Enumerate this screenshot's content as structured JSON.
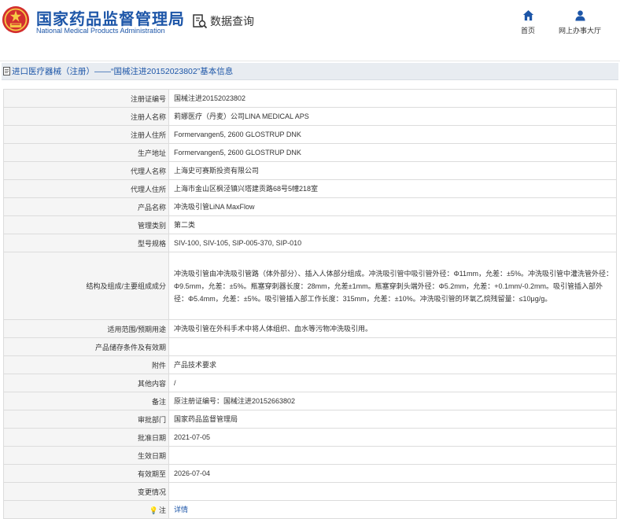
{
  "header": {
    "org_cn": "国家药品监督管理局",
    "org_en": "National Medical Products Administration",
    "query_label": "数据查询",
    "query_icon": "search-document-icon",
    "nav": [
      {
        "label": "首页",
        "icon": "home-icon"
      },
      {
        "label": "网上办事大厅",
        "icon": "user-icon"
      }
    ],
    "brand_color": "#1d56a8",
    "emblem_color": "#d32f2f"
  },
  "title_bar": {
    "text": "进口医疗器械（注册）——“国械注进20152023802”基本信息"
  },
  "rows": [
    {
      "label": "注册证编号",
      "value": "国械注进20152023802"
    },
    {
      "label": "注册人名称",
      "value": "莉娜医疗（丹麦）公司LINA MEDICAL APS"
    },
    {
      "label": "注册人住所",
      "value": "Formervangen5, 2600 GLOSTRUP DNK"
    },
    {
      "label": "生产地址",
      "value": "Formervangen5, 2600 GLOSTRUP DNK"
    },
    {
      "label": "代理人名称",
      "value": "上海史可赛斯投资有限公司"
    },
    {
      "label": "代理人住所",
      "value": "上海市金山区枫泾镇兴塔建贡路68号5幢218室"
    },
    {
      "label": "产品名称",
      "value": "冲洗吸引管LiNA MaxFlow"
    },
    {
      "label": "管理类别",
      "value": "第二类"
    },
    {
      "label": "型号规格",
      "value": "SIV-100, SIV-105, SIP-005-370, SIP-010"
    },
    {
      "label": "结构及组成/主要组成成分",
      "value": "冲洗吸引管由冲洗吸引管路（体外部分）、插入人体部分组成。冲洗吸引管中吸引管外径：Φ11mm，允差：±5%。冲洗吸引管中灌洗管外径：Φ9.5mm，允差：±5%。瓶塞穿刺器长度：28mm，允差±1mm。瓶塞穿刺头端外径：Φ5.2mm，允差：+0.1mm/-0.2mm。吸引管插入部外径：Φ5.4mm，允差：±5%。吸引管插入部工作长度：315mm，允差：±10%。冲洗吸引管的环氧乙烷残留量：≤10μg/g。"
    },
    {
      "label": "适用范围/预期用途",
      "value": "冲洗吸引管在外科手术中将人体组织、血水等污物冲洗吸引用。"
    },
    {
      "label": "产品储存条件及有效期",
      "value": ""
    },
    {
      "label": "附件",
      "value": "产品技术要求"
    },
    {
      "label": "其他内容",
      "value": "/"
    },
    {
      "label": "备注",
      "value": "原注册证编号：国械注进20152663802"
    },
    {
      "label": "审批部门",
      "value": "国家药品监督管理局"
    },
    {
      "label": "批准日期",
      "value": "2021-07-05"
    },
    {
      "label": "生效日期",
      "value": ""
    },
    {
      "label": "有效期至",
      "value": "2026-07-04"
    },
    {
      "label": "变更情况",
      "value": ""
    },
    {
      "label": "注",
      "value": "详情",
      "icon": "lightbulb-icon"
    }
  ]
}
